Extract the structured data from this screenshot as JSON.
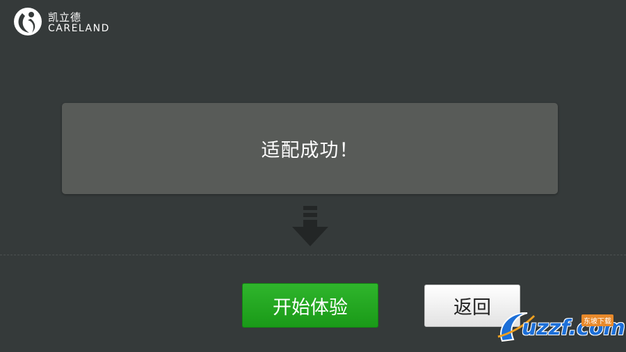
{
  "logo": {
    "chinese": "凯立德",
    "english": "CARELAND"
  },
  "dialog": {
    "message": "适配成功！"
  },
  "buttons": {
    "start": "开始体验",
    "back": "返回"
  },
  "watermark": {
    "text": "uzzf.com",
    "tag": "东坡下载"
  },
  "colors": {
    "background": "#353a3a",
    "panel": "#585b58",
    "start_button": "#22a520",
    "back_button": "#f2f2f2"
  }
}
